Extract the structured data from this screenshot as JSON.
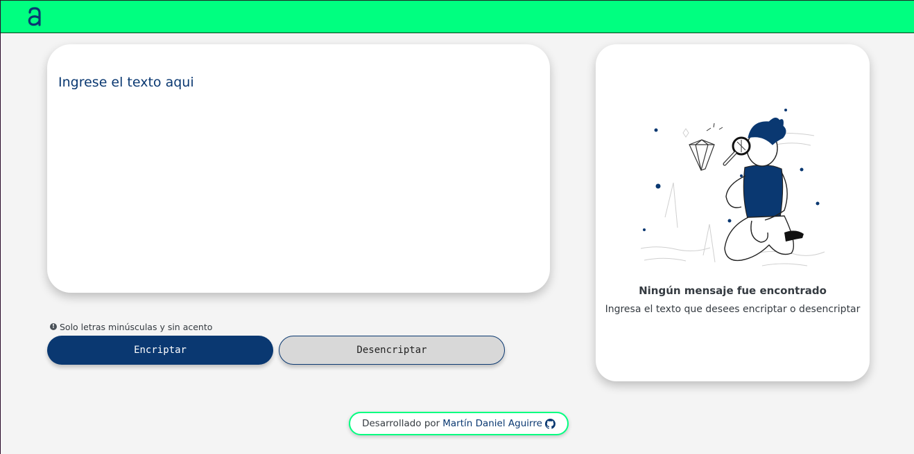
{
  "header": {
    "logo_icon": "alura-a-logo-icon",
    "bar_color": "#00ff80"
  },
  "input": {
    "placeholder": "Ingrese el texto aqui",
    "value": ""
  },
  "hint": {
    "icon": "info-circle-icon",
    "text": "Solo letras minúsculas y sin acento"
  },
  "buttons": {
    "encrypt": "Encriptar",
    "decrypt": "Desencriptar"
  },
  "output": {
    "illustration": "person-with-magnifying-glass-illustration",
    "title": "Ningún mensaje fue encontrado",
    "subtitle": "Ingresa el texto que desees encriptar o desencriptar"
  },
  "footer": {
    "prefix": "Desarrollado por",
    "author": "Martín Daniel Aguirre",
    "icon": "github-icon"
  },
  "colors": {
    "accent": "#00ff80",
    "primary": "#0a3871",
    "background": "#f4f4f4"
  }
}
